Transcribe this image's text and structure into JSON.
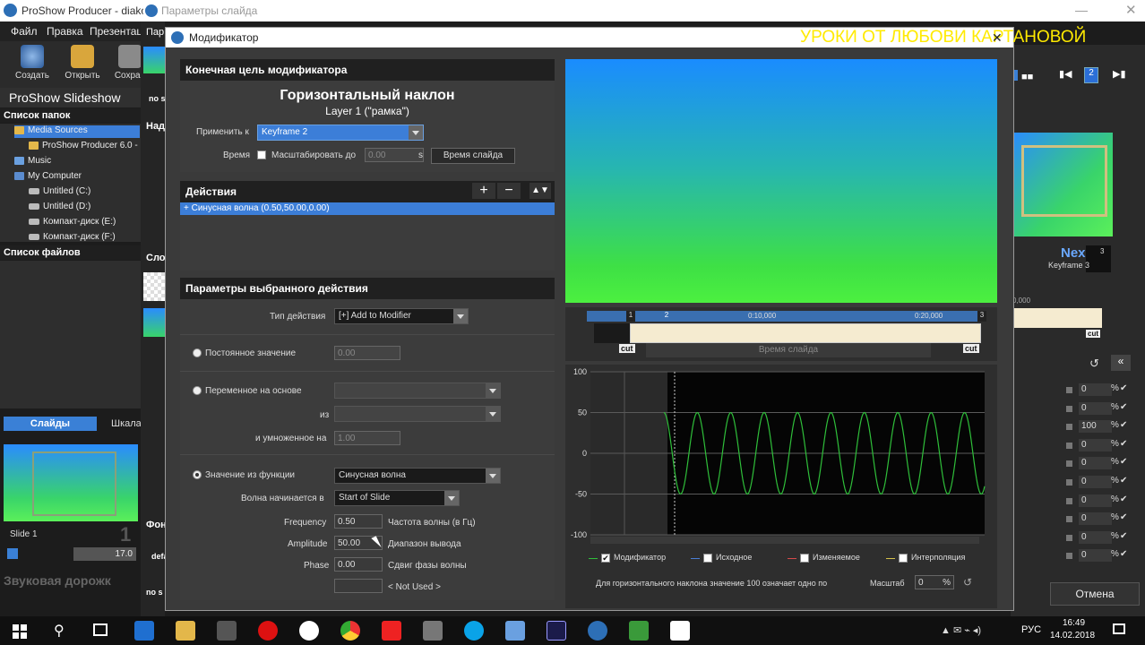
{
  "main_window": {
    "title": "ProShow Producer - diakov",
    "menu": [
      "Файл",
      "Правка",
      "Презентац"
    ],
    "toolbar": [
      {
        "label": "Создать",
        "icon": "new-show-icon"
      },
      {
        "label": "Открыть",
        "icon": "open-folder-icon"
      },
      {
        "label": "Сохран",
        "icon": "save-icon"
      }
    ],
    "app_label": "ProShow Slideshow",
    "folders_header": "Список папок",
    "folders": [
      {
        "label": "Media Sources",
        "selected": true
      },
      {
        "label": "ProShow Producer 6.0 -"
      },
      {
        "label": "Music"
      },
      {
        "label": "My Computer"
      },
      {
        "label": "Untitled (C:)"
      },
      {
        "label": "Untitled (D:)"
      },
      {
        "label": "Компакт-диск (E:)"
      },
      {
        "label": "Компакт-диск (F:)"
      }
    ],
    "files_header": "Список файлов",
    "tabs": {
      "slides": "Слайды",
      "timeline": "Шкала"
    },
    "slide": {
      "name": "Slide 1",
      "number": "1",
      "duration": "17.0"
    },
    "audio_track": "Звуковая дорожк",
    "mid_labels": {
      "par": "Пар",
      "nad": "Над",
      "slo": "Сло",
      "fon": "Фон",
      "no_s": "no s",
      "def": "defa"
    }
  },
  "slide_window": {
    "title": "Параметры слайда",
    "overlay_text": "УРОКИ ОТ ЛЮБОВИ КАРТАНОВОЙ",
    "right_panel": {
      "next_label": "Nex",
      "keyframe_label": "Keyframe 3",
      "keyframe_badge": "3",
      "timeline_value": "0,000",
      "cut_label": "cut",
      "nav_badge": "2",
      "values": [
        "0",
        "0",
        "100",
        "0",
        "0",
        "0",
        "0",
        "0",
        "0",
        "0"
      ],
      "percent": "%",
      "cancel_button": "Отмена"
    }
  },
  "modal": {
    "title": "Модификатор",
    "target_header": "Конечная цель модификатора",
    "target_name": "Горизонтальный наклон",
    "target_layer": "Layer 1 (\"рамка\")",
    "apply_to_label": "Применить к",
    "apply_to_value": "Keyframe 2",
    "time_label": "Время",
    "scale_to_label": "Масштабировать до",
    "scale_to_value": "0.00",
    "scale_unit": "s",
    "slide_time_button": "Время слайда",
    "actions_header": "Действия",
    "actions": [
      "+ Синусная волна (0.50,50.00,0.00)"
    ],
    "params_header": "Параметры выбранного действия",
    "action_type_label": "Тип действия",
    "action_type_value": "[+] Add to Modifier",
    "constant_label": "Постоянное значение",
    "constant_value": "0.00",
    "variable_label": "Переменное на основе",
    "from_label": "из",
    "multiplied_label": "и умноженное на",
    "multiplied_value": "1.00",
    "function_label": "Значение из функции",
    "function_value": "Синусная волна",
    "wave_start_label": "Волна начинается в",
    "wave_start_value": "Start of Slide",
    "frequency_label": "Frequency",
    "frequency_value": "0.50",
    "frequency_desc": "Частота волны (в Гц)",
    "amplitude_label": "Amplitude",
    "amplitude_value": "50.00",
    "amplitude_desc": "Диапазон вывода",
    "phase_label": "Phase",
    "phase_value": "0.00",
    "phase_desc": "Сдвиг фазы волны",
    "not_used": "< Not Used >",
    "timeline": {
      "ticks": [
        "0:10,000",
        "0:20,000"
      ],
      "keyframes": [
        "1",
        "2",
        "3"
      ],
      "cut_label": "cut",
      "slide_time": "Время слайда"
    },
    "graph": {
      "y_ticks": [
        "100",
        "50",
        "0",
        "-50",
        "-100"
      ],
      "legend": [
        {
          "label": "Модификатор",
          "checked": true,
          "color": "#2fbf3a"
        },
        {
          "label": "Исходное",
          "checked": false,
          "color": "#4a7fd6"
        },
        {
          "label": "Изменяемое",
          "checked": false,
          "color": "#d64a4a"
        },
        {
          "label": "Интерполяция",
          "checked": false,
          "color": "#d6c24a"
        }
      ],
      "footer_text": "Для горизонтального наклона значение 100 означает одно по",
      "scale_label": "Масштаб",
      "scale_value": "0",
      "scale_unit": "%"
    }
  },
  "taskbar": {
    "language": "РУС",
    "time": "16:49",
    "date": "14.02.2018"
  }
}
